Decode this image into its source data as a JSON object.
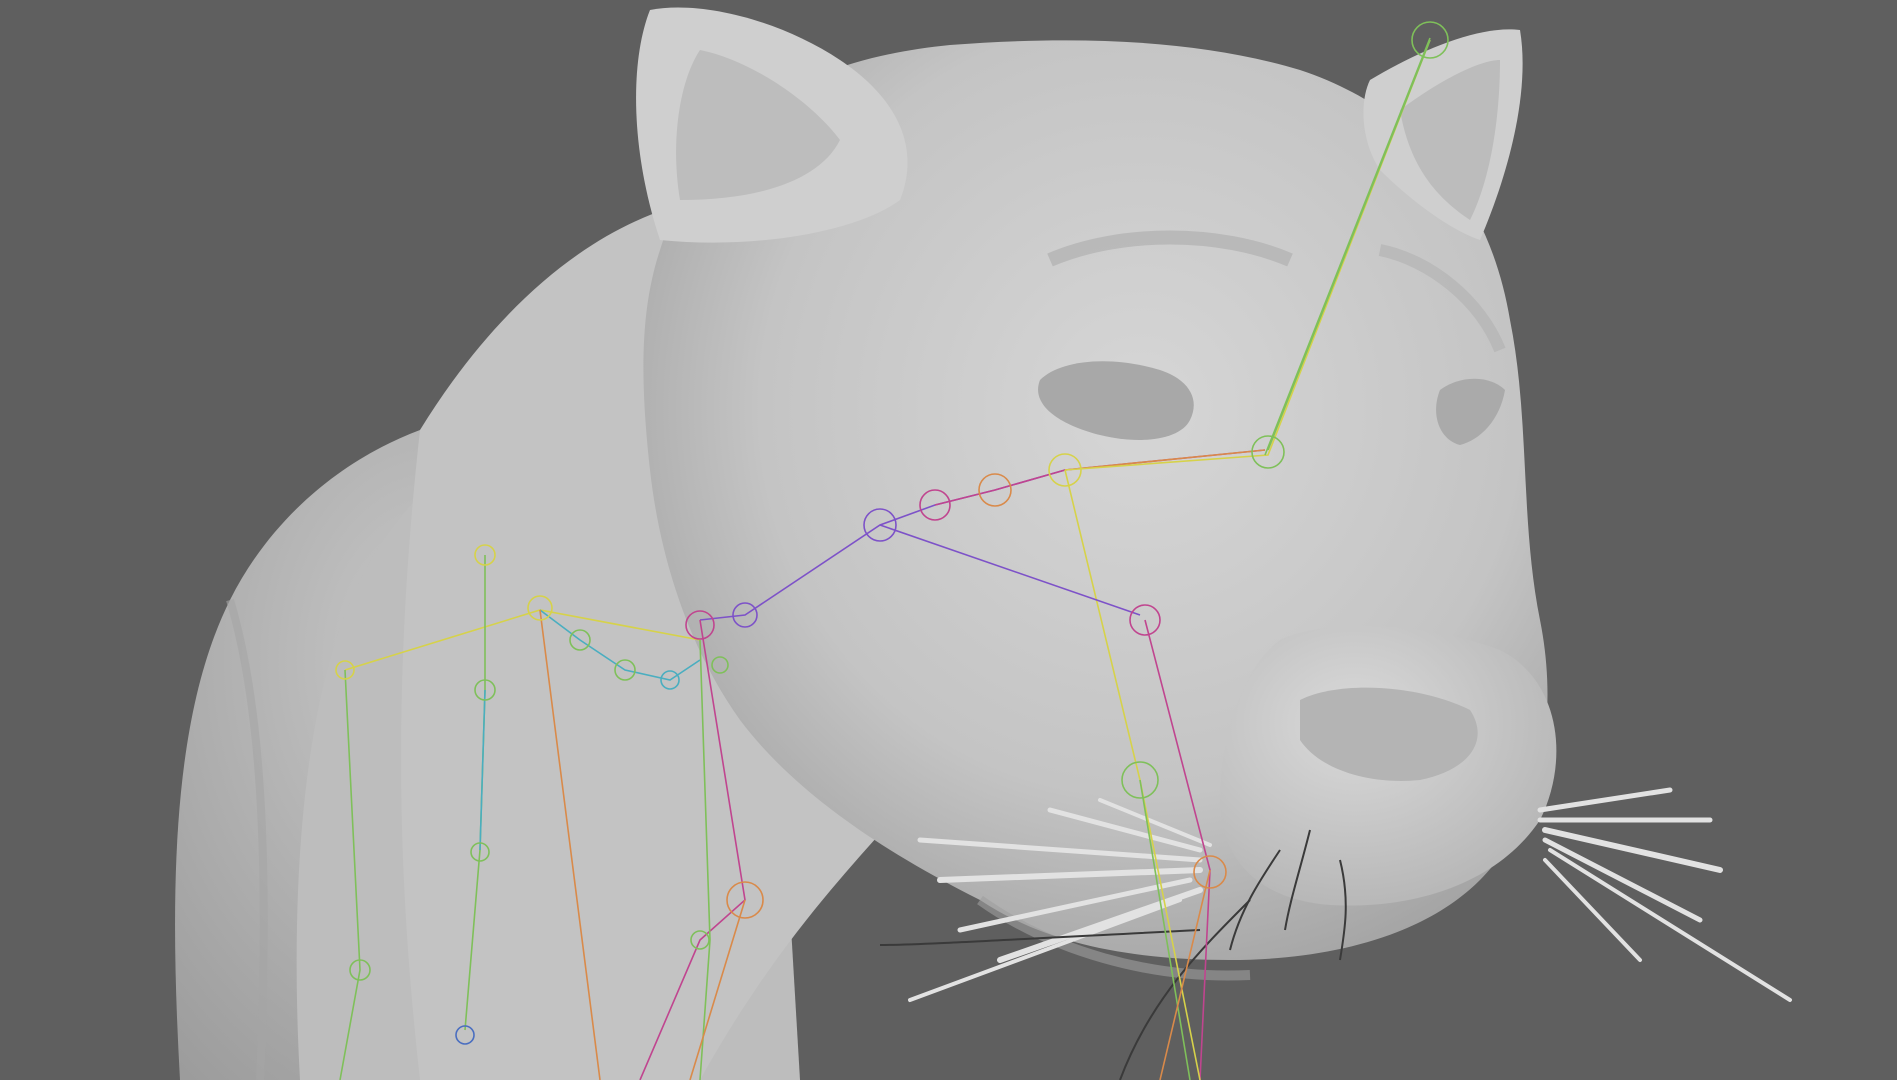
{
  "scene": {
    "subject": "panther-head-sculpt",
    "background_color": "#5f5f5f",
    "mesh_color": "#c9c9c9",
    "rig_colors": {
      "green": "#7fc05a",
      "yellow": "#d6d24a",
      "orange": "#d98a4a",
      "magenta": "#c0458f",
      "purple": "#7d52c8",
      "cyan": "#4aaec0",
      "blue": "#4a6ec0"
    },
    "icons": [
      "armature-bone-icon",
      "armature-joint-icon",
      "whisker-strand-icon"
    ]
  }
}
